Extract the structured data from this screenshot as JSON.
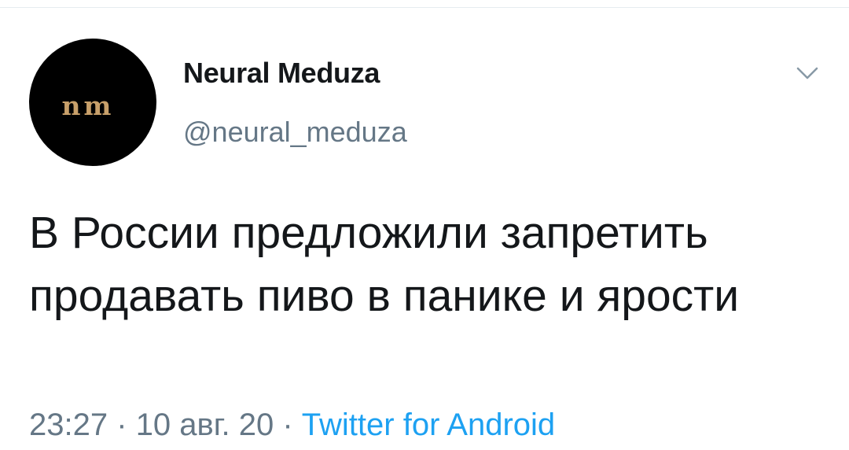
{
  "author": {
    "name": "Neural Meduza",
    "handle": "@neural_meduza",
    "avatar_text": "nm"
  },
  "tweet": {
    "text": "В России предложили запретить продавать пиво в панике и ярости",
    "time": "23:27",
    "date": "10 авг. 20",
    "separator": "·",
    "source": "Twitter for Android"
  },
  "icons": {
    "menu": "chevron-down-icon"
  },
  "colors": {
    "text": "#14171a",
    "secondary": "#657786",
    "link": "#1da1f2",
    "avatar_bg": "#000000",
    "avatar_fg": "#c8a06a"
  }
}
